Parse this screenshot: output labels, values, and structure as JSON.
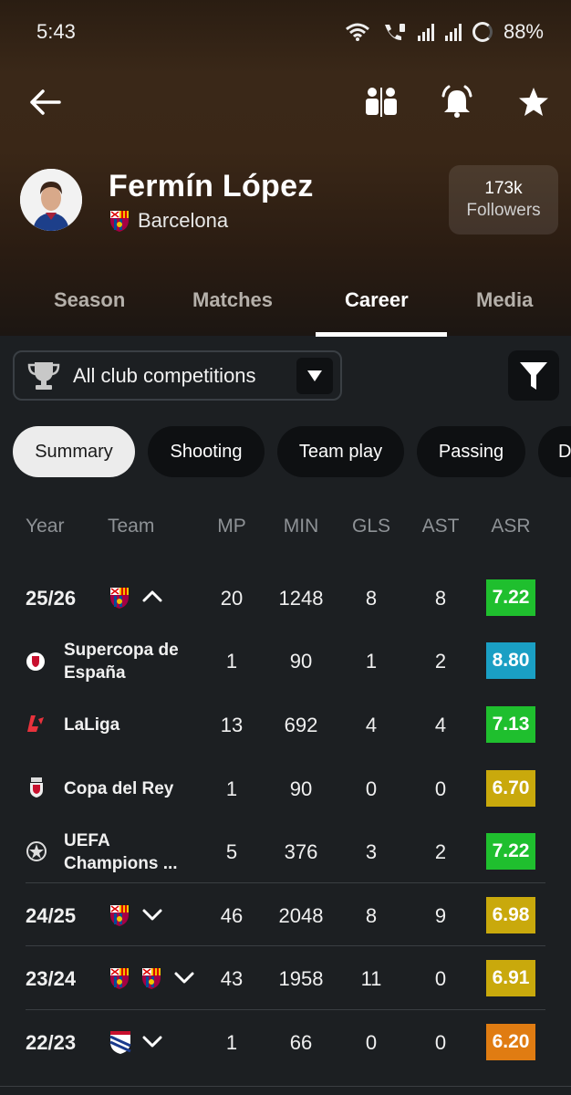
{
  "status_bar": {
    "time": "5:43",
    "battery": "88%"
  },
  "header": {
    "icons": [
      "back-arrow-icon",
      "compare-icon",
      "bell-icon",
      "star-icon"
    ]
  },
  "player": {
    "name": "Fermín López",
    "club": "Barcelona",
    "followers_count": "173k",
    "followers_label": "Followers"
  },
  "tabs": [
    {
      "label": "Season"
    },
    {
      "label": "Matches"
    },
    {
      "label": "Career",
      "active": true
    },
    {
      "label": "Media"
    }
  ],
  "filter": {
    "competition": "All club competitions"
  },
  "chips": [
    {
      "label": "Summary",
      "active": true
    },
    {
      "label": "Shooting"
    },
    {
      "label": "Team play"
    },
    {
      "label": "Passing"
    },
    {
      "label": "D"
    }
  ],
  "table": {
    "headers": {
      "year": "Year",
      "team": "Team",
      "mp": "MP",
      "min": "MIN",
      "gls": "GLS",
      "ast": "AST",
      "asr": "ASR"
    },
    "rows": [
      {
        "year": "25/26",
        "mp": "20",
        "min": "1248",
        "gls": "8",
        "ast": "8",
        "asr": "7.22",
        "asr_color": "#1fbf2e",
        "expanded": true
      },
      {
        "comp": "Supercopa de España",
        "comp_line1": "Supercopa de",
        "comp_line2": "España",
        "mp": "1",
        "min": "90",
        "gls": "1",
        "ast": "2",
        "asr": "8.80",
        "asr_color": "#1a9fc4"
      },
      {
        "comp": "LaLiga",
        "mp": "13",
        "min": "692",
        "gls": "4",
        "ast": "4",
        "asr": "7.13",
        "asr_color": "#1fbf2e"
      },
      {
        "comp": "Copa del Rey",
        "mp": "1",
        "min": "90",
        "gls": "0",
        "ast": "0",
        "asr": "6.70",
        "asr_color": "#c9a90c"
      },
      {
        "comp": "UEFA Champions ...",
        "comp_line1": "UEFA",
        "comp_line2": "Champions ...",
        "mp": "5",
        "min": "376",
        "gls": "3",
        "ast": "2",
        "asr": "7.22",
        "asr_color": "#1fbf2e"
      },
      {
        "year": "24/25",
        "mp": "46",
        "min": "2048",
        "gls": "8",
        "ast": "9",
        "asr": "6.98",
        "asr_color": "#c9a90c"
      },
      {
        "year": "23/24",
        "mp": "43",
        "min": "1958",
        "gls": "11",
        "ast": "0",
        "asr": "6.91",
        "asr_color": "#c9a90c"
      },
      {
        "year": "22/23",
        "mp": "1",
        "min": "66",
        "gls": "0",
        "ast": "0",
        "asr": "6.20",
        "asr_color": "#e07c12"
      }
    ]
  }
}
